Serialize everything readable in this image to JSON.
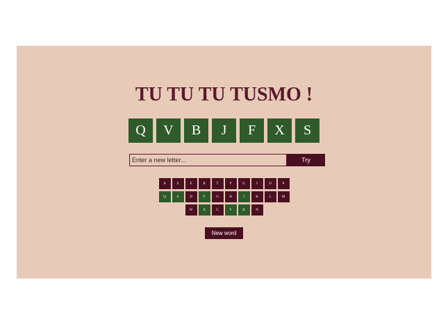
{
  "title": "TU TU TU TUSMO !",
  "word_letters": [
    "Q",
    "V",
    "B",
    "J",
    "F",
    "X",
    "S"
  ],
  "input": {
    "placeholder": "Enter a new letter...",
    "value": ""
  },
  "try_button": "Try",
  "keyboard": [
    [
      {
        "letter": "A",
        "state": "used"
      },
      {
        "letter": "Z",
        "state": "used"
      },
      {
        "letter": "E",
        "state": "used"
      },
      {
        "letter": "R",
        "state": "used"
      },
      {
        "letter": "T",
        "state": "used"
      },
      {
        "letter": "Y",
        "state": "used"
      },
      {
        "letter": "U",
        "state": "used"
      },
      {
        "letter": "I",
        "state": "used"
      },
      {
        "letter": "O",
        "state": "used"
      },
      {
        "letter": "P",
        "state": "used"
      }
    ],
    [
      {
        "letter": "Q",
        "state": "found"
      },
      {
        "letter": "S",
        "state": "found"
      },
      {
        "letter": "D",
        "state": "used"
      },
      {
        "letter": "F",
        "state": "found"
      },
      {
        "letter": "G",
        "state": "used"
      },
      {
        "letter": "H",
        "state": "used"
      },
      {
        "letter": "J",
        "state": "found"
      },
      {
        "letter": "K",
        "state": "used"
      },
      {
        "letter": "L",
        "state": "used"
      },
      {
        "letter": "M",
        "state": "used"
      }
    ],
    [
      {
        "letter": "W",
        "state": "used"
      },
      {
        "letter": "X",
        "state": "found"
      },
      {
        "letter": "C",
        "state": "used"
      },
      {
        "letter": "V",
        "state": "found"
      },
      {
        "letter": "B",
        "state": "found"
      },
      {
        "letter": "N",
        "state": "used"
      }
    ]
  ],
  "new_word_button": "New word",
  "colors": {
    "background": "#e8cab8",
    "found": "#2f5a2a",
    "used": "#4b0f22",
    "title": "#5a1a2b"
  }
}
